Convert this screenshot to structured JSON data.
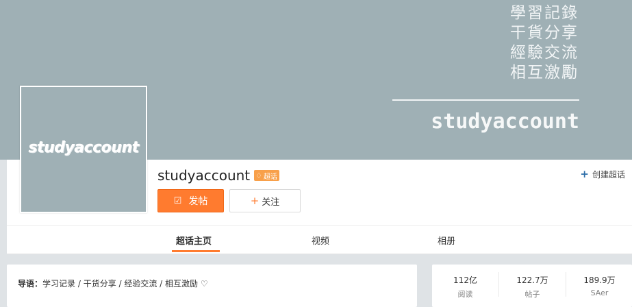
{
  "banner": {
    "lines": [
      "學習記錄",
      "干貨分享",
      "經驗交流",
      "相互激勵"
    ],
    "name": "studyaccount"
  },
  "avatar": {
    "text": "studyaccount"
  },
  "header": {
    "title": "studyaccount",
    "badge": "超话",
    "post_label": "发帖",
    "follow_label": "关注",
    "create_label": "创建超话"
  },
  "tabs": [
    {
      "label": "超话主页",
      "active": true
    },
    {
      "label": "视频",
      "active": false
    },
    {
      "label": "相册",
      "active": false
    }
  ],
  "intro": {
    "label": "导语：",
    "text": "学习记录 / 干货分享 / 经验交流 / 相互激励 ♡"
  },
  "stats": [
    {
      "value": "112亿",
      "label": "阅读"
    },
    {
      "value": "122.7万",
      "label": "帖子"
    },
    {
      "value": "189.9万",
      "label": "SAer"
    }
  ],
  "colors": {
    "banner": "#9fb0b5",
    "accent": "#ff7b2f",
    "badge": "#f8a04a",
    "link": "#2d6ea9"
  },
  "icons": {
    "post": "edit-icon",
    "follow": "plus-icon",
    "create": "plus-icon",
    "badge": "diamond-icon"
  }
}
